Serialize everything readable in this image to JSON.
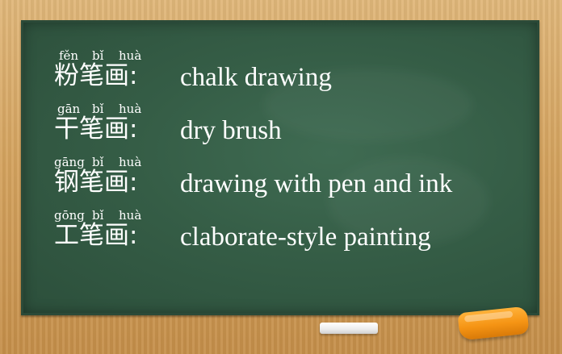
{
  "rows": [
    {
      "pinyin": [
        "fěn",
        "bǐ",
        "huà"
      ],
      "hanzi": "粉笔画:",
      "english": "chalk drawing"
    },
    {
      "pinyin": [
        "gān",
        "bǐ",
        "huà"
      ],
      "hanzi": "干笔画:",
      "english": "dry brush"
    },
    {
      "pinyin": [
        "gāng",
        "bǐ",
        "huà"
      ],
      "hanzi": "钢笔画:",
      "english": "drawing with pen and ink"
    },
    {
      "pinyin": [
        "gōng",
        "bǐ",
        "huà"
      ],
      "hanzi": "工笔画:",
      "english": "claborate-style painting"
    }
  ],
  "colors": {
    "board": "#355d46",
    "frame": "#d4a35f",
    "text": "#ffffff",
    "chalk_orange": "#f59414"
  }
}
